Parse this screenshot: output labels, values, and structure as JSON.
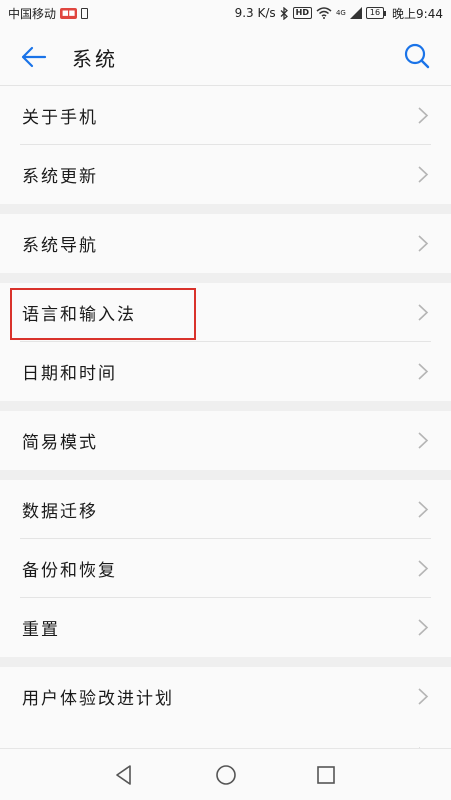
{
  "statusbar": {
    "carrier": "中国移动",
    "speed": "9.3 K/s",
    "hd": "HD",
    "network": "4G",
    "battery": "16",
    "time": "晚上9:44"
  },
  "header": {
    "title": "系统",
    "back_icon": "arrow-left-icon",
    "search_icon": "search-icon",
    "accent": "#1a73e8"
  },
  "settings": [
    {
      "label": "关于手机"
    },
    {
      "label": "系统更新"
    },
    {
      "label": "系统导航"
    },
    {
      "label": "语言和输入法"
    },
    {
      "label": "日期和时间"
    },
    {
      "label": "简易模式"
    },
    {
      "label": "数据迁移"
    },
    {
      "label": "备份和恢复"
    },
    {
      "label": "重置"
    },
    {
      "label": "用户体验改进计划"
    }
  ],
  "highlight_color": "#d9322b",
  "navbar": {
    "back_icon": "triangle-back-icon",
    "home_icon": "circle-home-icon",
    "recents_icon": "square-recents-icon"
  }
}
